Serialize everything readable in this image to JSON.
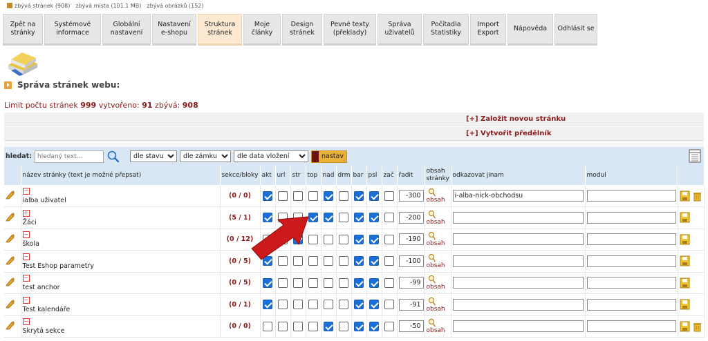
{
  "status": {
    "items": [
      "zbývá stránek (908)",
      "zbývá místa (101.1 MB)",
      "zbývá obrázků (152)"
    ]
  },
  "menu": [
    {
      "label": "Zpět na\nstránky",
      "active": false
    },
    {
      "label": "Systémové\ninformace",
      "active": false
    },
    {
      "label": "Globální\nnastavení",
      "active": false
    },
    {
      "label": "Nastavení\ne-shopu",
      "active": false
    },
    {
      "label": "Struktura\nstránek",
      "active": true
    },
    {
      "label": "Moje\nčlánky",
      "active": false
    },
    {
      "label": "Design\nstránek",
      "active": false
    },
    {
      "label": "Pevné texty\n(překlady)",
      "active": false
    },
    {
      "label": "Správa\nuživatelů",
      "active": false
    },
    {
      "label": "Počítadla\nStatistiky",
      "active": false
    },
    {
      "label": "Import\nExport",
      "active": false
    },
    {
      "label": "Nápověda",
      "active": false
    },
    {
      "label": "Odhlásit se",
      "active": false
    }
  ],
  "page": {
    "title": "Správa stránek webu:",
    "limit_prefix": "Limit počtu stránek",
    "limit_total": "999",
    "created_label": "vytvořeno:",
    "created": "91",
    "remaining_label": "zbývá:",
    "remaining": "908"
  },
  "actions": {
    "new_page": "[+] Založit novou stránku",
    "new_divider": "[+] Vytvořit předělník"
  },
  "filter": {
    "label": "hledat:",
    "placeholder": "hledaný text...",
    "state": "dle stavu",
    "lock": "dle zámku",
    "date": "dle data vložení",
    "apply": "nastav"
  },
  "columns": {
    "name": "název stránky (text je možné přepsat)",
    "sections": "sekce/bloky",
    "akt": "akt",
    "url": "url",
    "str": "str",
    "top": "top",
    "nad": "nad",
    "drm": "drm",
    "bar": "bar",
    "psl": "psl",
    "zac": "zač",
    "order": "řadit",
    "content": "obsah\nstránky",
    "link": "odkazovat jinam",
    "module": "modul"
  },
  "content_label": "obsah",
  "rows": [
    {
      "toggle": "−",
      "name": "ialba uživatel",
      "sections": "0",
      "blocks": "0",
      "akt": true,
      "url": false,
      "str": false,
      "top": false,
      "nad": true,
      "drm": false,
      "bar": true,
      "psl": true,
      "zac": false,
      "order": "-300",
      "link": "i-alba-nick-obchodsu",
      "module": "",
      "trash": true
    },
    {
      "toggle": "+",
      "name": "Žáci",
      "sections": "5",
      "blocks": "1",
      "akt": true,
      "url": false,
      "str": false,
      "top": true,
      "nad": true,
      "drm": false,
      "bar": true,
      "psl": true,
      "zac": false,
      "order": "-200",
      "link": "",
      "module": "",
      "trash": false
    },
    {
      "toggle": "−",
      "name": "škola",
      "sections": "0",
      "blocks": "12",
      "akt": false,
      "url": false,
      "str": true,
      "top": false,
      "nad": false,
      "drm": false,
      "bar": true,
      "psl": true,
      "zac": false,
      "order": "-190",
      "link": "",
      "module": "",
      "trash": false
    },
    {
      "toggle": "−",
      "name": "Test Eshop parametry",
      "sections": "0",
      "blocks": "5",
      "akt": true,
      "url": false,
      "str": false,
      "top": false,
      "nad": false,
      "drm": false,
      "bar": true,
      "psl": true,
      "zac": false,
      "order": "-100",
      "link": "",
      "module": "",
      "trash": false
    },
    {
      "toggle": "−",
      "name": "test anchor",
      "sections": "0",
      "blocks": "5",
      "akt": true,
      "url": false,
      "str": false,
      "top": false,
      "nad": false,
      "drm": false,
      "bar": true,
      "psl": true,
      "zac": false,
      "order": "-99",
      "link": "",
      "module": "",
      "trash": false
    },
    {
      "toggle": "−",
      "name": "Test kalendáře",
      "sections": "0",
      "blocks": "1",
      "akt": true,
      "url": false,
      "str": false,
      "top": false,
      "nad": false,
      "drm": false,
      "bar": true,
      "psl": true,
      "zac": false,
      "order": "-91",
      "link": "",
      "module": "",
      "trash": false
    },
    {
      "toggle": "−",
      "name": "Skrytá sekce",
      "sections": "0",
      "blocks": "0",
      "akt": false,
      "url": false,
      "str": false,
      "top": false,
      "nad": true,
      "drm": false,
      "bar": true,
      "psl": true,
      "zac": false,
      "order": "-50",
      "link": "",
      "module": "",
      "trash": true
    }
  ],
  "colors": {
    "accent": "#8a1a1a",
    "header_bg": "#d9e7f5",
    "checkbox_on": "#1a6fd6",
    "arrow": "#cc1a1a"
  }
}
